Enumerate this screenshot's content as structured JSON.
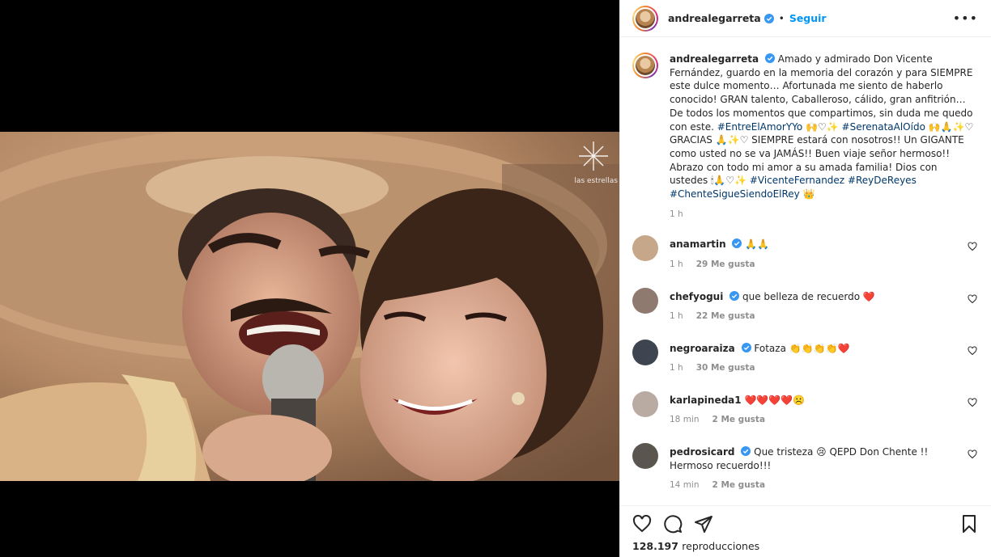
{
  "media": {
    "watermark": "las estrellas"
  },
  "post": {
    "username": "andrealegarreta",
    "follow_label": "Seguir",
    "more_label": "•••",
    "dot": "•"
  },
  "caption": {
    "username": "andrealegarreta",
    "text1": "Amado y admirado Don Vicente Fernández, guardo en la memoria del corazón y para SIEMPRE este dulce momento… Afortunada me siento de haberlo conocido! GRAN talento, Caballeroso, cálido, gran anfitrión… De todos los momentos que compartimos, sin duda me quedo con este.",
    "tag1": "#EntreElAmorYYo",
    "emoji1": " 🙌♡✨ ",
    "tag2": "#SerenataAlOído",
    "emoji2": " 🙌🙏✨♡ GRACIAS 🙏✨♡ SIEMPRE estará con nosotros!! Un GIGANTE como usted no se va JAMÁS!! Buen viaje señor hermoso!! Abrazo con todo mi amor a su amada familia! Dios con ustedes 🕯🙏♡✨ ",
    "tag3": "#VicenteFernandez",
    "tag4": "#ReyDeReyes",
    "tag5": "#ChenteSigueSiendoElRey",
    "emoji3": " 👑",
    "time": "1 h"
  },
  "comments": [
    {
      "user": "anamartin",
      "text": "🙏🙏",
      "time": "1 h",
      "likes": "29 Me gusta"
    },
    {
      "user": "chefyogui",
      "text": "que belleza de recuerdo ❤️",
      "time": "1 h",
      "likes": "22 Me gusta"
    },
    {
      "user": "negroaraiza",
      "text": "Fotaza 👏👏👏👏❤️",
      "time": "1 h",
      "likes": "30 Me gusta"
    },
    {
      "user": "karlapineda1",
      "text": "❤️❤️❤️❤️☹️",
      "time": "18 min",
      "likes": "2 Me gusta"
    },
    {
      "user": "pedrosicard",
      "text": "Que tristeza 😢 QEPD Don Chente !! Hermoso recuerdo!!!",
      "time": "14 min",
      "likes": "2 Me gusta"
    }
  ],
  "stats": {
    "views_count": "128.197",
    "views_label": "reproducciones"
  },
  "colors": {
    "accent": "#0095f6",
    "verified": "#3897f0",
    "heart": "#ed4956"
  }
}
